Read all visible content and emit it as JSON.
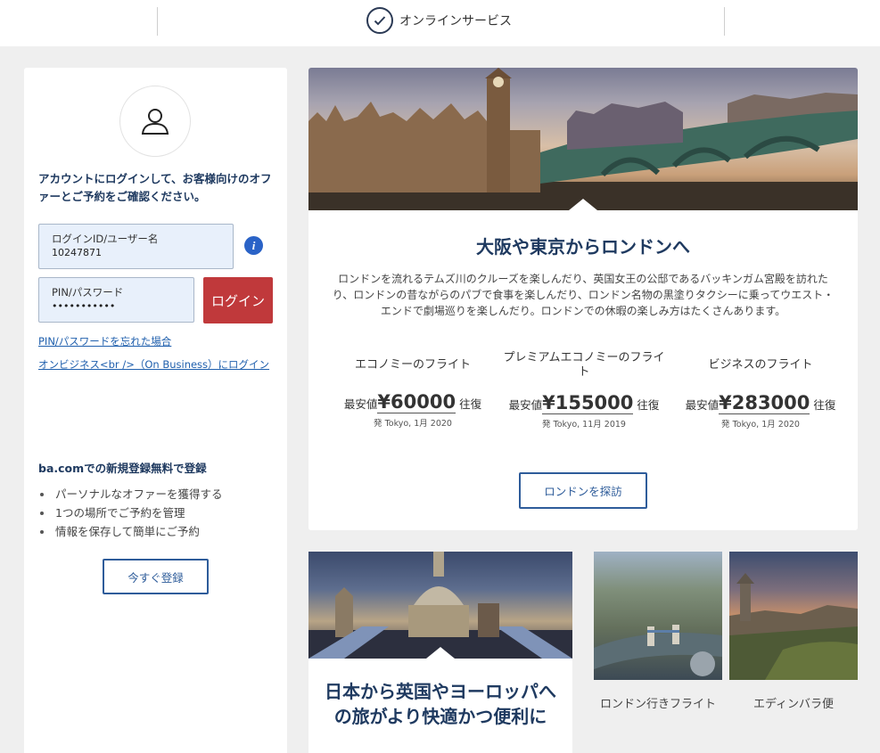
{
  "header": {
    "service_label": "オンラインサービス"
  },
  "login": {
    "intro": "アカウントにログインして、お客様向けのオファーとご予約をご確認ください。",
    "id_label": "ログインID/ユーザー名",
    "id_value": "10247871",
    "pw_label": "PIN/パスワード",
    "pw_value": "•••••••••••",
    "login_button": "ログイン",
    "forgot_link": "PIN/パスワードを忘れた場合",
    "business_link": "オンビジネス<br />（On Business）にログイン"
  },
  "register": {
    "title": "ba.comでの新規登録無料で登録",
    "benefits": [
      "パーソナルなオファーを獲得する",
      "1つの場所でご予約を管理",
      "情報を保存して簡単にご予約"
    ],
    "button": "今すぐ登録"
  },
  "feature": {
    "headline": "大阪や東京からロンドンへ",
    "description": "ロンドンを流れるテムズ川のクルーズを楽しんだり、英国女王の公邸であるバッキンガム宮殿を訪れたり、ロンドンの昔ながらのパブで食事を楽しんだり、ロンドン名物の黒塗りタクシーに乗ってウエスト・エンドで劇場巡りを楽しんだり。ロンドンでの休暇の楽しみ方はたくさんあります。",
    "fares": [
      {
        "name": "エコノミーのフライト",
        "prefix": "最安値",
        "price": "¥60000",
        "suffix": "往復",
        "origin": "発 Tokyo, 1月 2020"
      },
      {
        "name": "プレミアムエコノミーのフライト",
        "prefix": "最安値",
        "price": "¥155000",
        "suffix": "往復",
        "origin": "発 Tokyo, 11月 2019"
      },
      {
        "name": "ビジネスのフライト",
        "prefix": "最安値",
        "price": "¥283000",
        "suffix": "往復",
        "origin": "発 Tokyo, 1月 2020"
      }
    ],
    "explore_button": "ロンドンを探訪"
  },
  "promo": {
    "title": "日本から英国やヨーロッパへの旅がより快適かつ便利に"
  },
  "destinations": [
    {
      "caption": "ロンドン行きフライト"
    },
    {
      "caption": "エディンバラ便"
    }
  ]
}
